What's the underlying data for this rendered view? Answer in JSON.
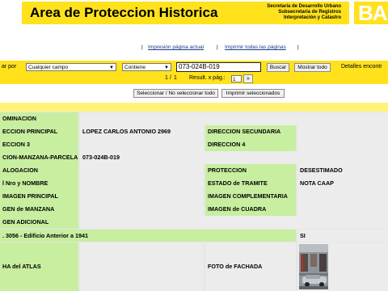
{
  "header": {
    "title": "Area de Proteccion Historica",
    "sub_lines": [
      "Secretaría de Desarrollo Urbano",
      "Subsecretaría de Registros",
      "Interpretación y Catastro"
    ],
    "logo_text": "BA"
  },
  "links": {
    "print_page": "Impresión página actual",
    "print_all": "Imprimir todas las páginas",
    "separator": "|"
  },
  "search": {
    "label": "ar por",
    "field": "Cualquier campo",
    "operator": "Contiene",
    "value": "073-024B-019",
    "search_button": "Buscar",
    "show_all_button": "Mostrar todo",
    "details_label": "Detalles encontr"
  },
  "pager": {
    "current": "1",
    "total": "1",
    "results_label": "Result. x pág.:",
    "per_page": "1",
    "next_button": "»"
  },
  "selection": {
    "toggle_button": "Seleccionar / No seleccionar todo",
    "print_selected_button": "Imprimir seleccionados"
  },
  "record": {
    "denominacion_label": "OMINACION",
    "direccion_principal_label": "ECCION PRINCIPAL",
    "direccion_principal_value": "LOPEZ CARLOS ANTONIO 2969",
    "direccion_secundaria_label": "DIRECCION SECUNDARIA",
    "direccion3_label": "ECCION 3",
    "direccion4_label": "DIRECCION 4",
    "smp_label": "CION-MANZANA-PARCELA",
    "smp_value": "073-024B-019",
    "catalogacion_label": "ALOGACION",
    "proteccion_label": "PROTECCION",
    "proteccion_value": "DESESTIMADO",
    "nro_nombre_label": "l Nro y NOMBRE",
    "estado_tramite_label": "ESTADO de TRAMITE",
    "estado_tramite_value": "NOTA CAAP",
    "imagen_principal_label": "IMAGEN PRINCIPAL",
    "imagen_complementaria_label": "IMAGEN COMPLEMENTARIA",
    "imagen_manzana_label": "GEN de MANZANA",
    "imagen_cuadra_label": "IMAGEN de CUADRA",
    "imagen_adicional_label": "GEN ADICIONAL",
    "ley_label": ". 3056 - Edificio Anterior a 1941",
    "ley_value": "SI",
    "ficha_atlas_label": "HA del ATLAS",
    "foto_fachada_label": "FOTO de FACHADA"
  },
  "colors": {
    "brand_yellow": "#ffe21c",
    "pale_yellow": "#fff37a",
    "label_green": "#c8eea0",
    "value_gray": "#ececec",
    "link_blue": "#1a3a8a"
  },
  "icons": {
    "dropdown": "chevron-down-icon"
  }
}
